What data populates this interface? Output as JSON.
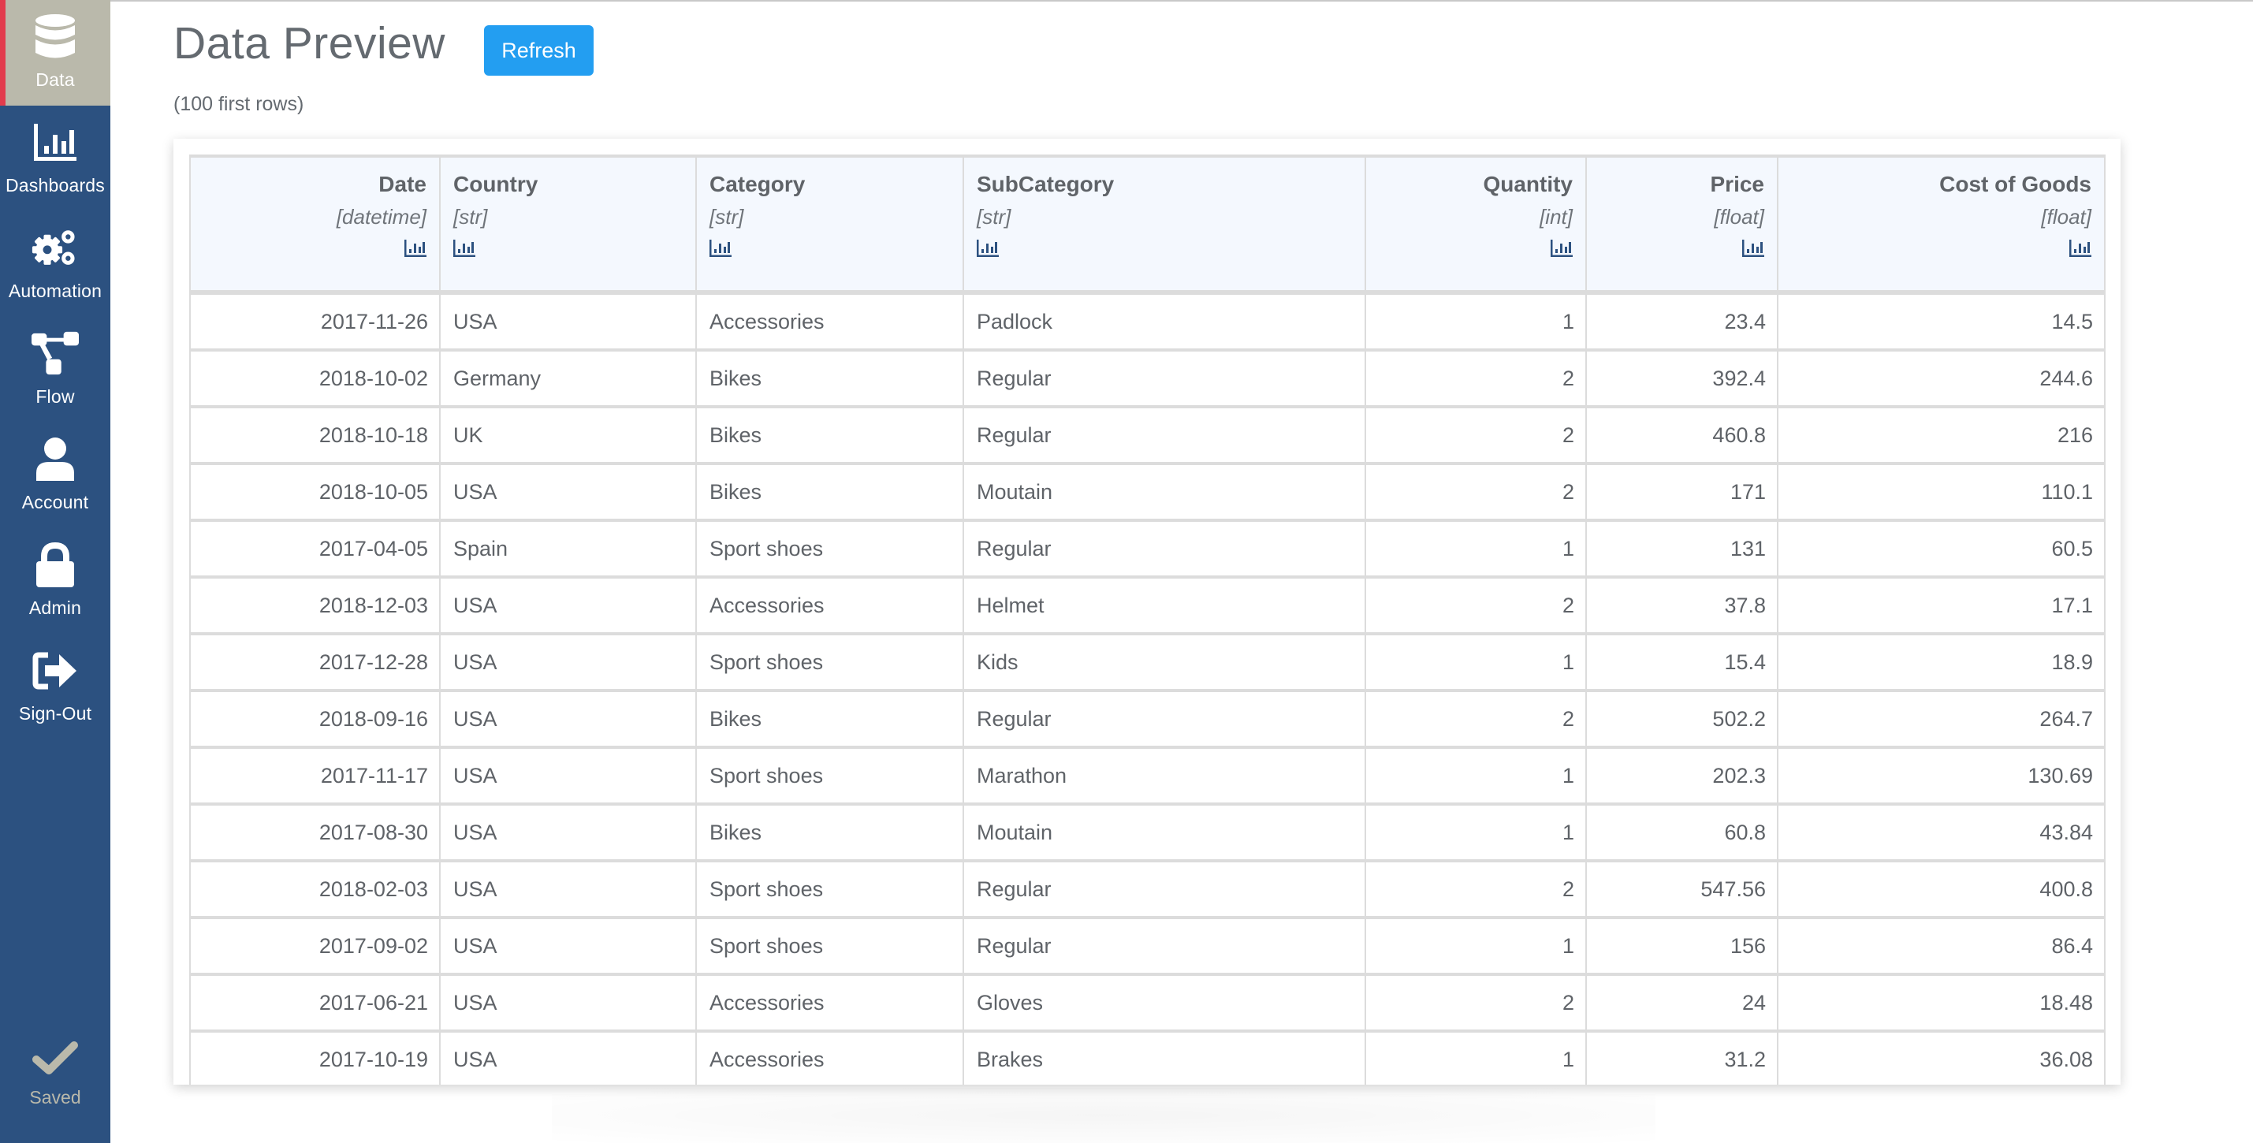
{
  "sidebar": {
    "items": [
      {
        "label": "Data",
        "icon": "database-icon",
        "active": true
      },
      {
        "label": "Dashboards",
        "icon": "bar-chart-icon",
        "active": false
      },
      {
        "label": "Automation",
        "icon": "gears-icon",
        "active": false
      },
      {
        "label": "Flow",
        "icon": "flow-icon",
        "active": false
      },
      {
        "label": "Account",
        "icon": "user-icon",
        "active": false
      },
      {
        "label": "Admin",
        "icon": "lock-icon",
        "active": false
      },
      {
        "label": "Sign-Out",
        "icon": "sign-out-icon",
        "active": false
      }
    ],
    "status": {
      "label": "Saved",
      "icon": "check-icon"
    }
  },
  "header": {
    "title": "Data Preview",
    "refresh_label": "Refresh",
    "subtitle": "(100 first rows)"
  },
  "colors": {
    "sidebar_bg": "#2c5180",
    "active_bg": "#bab9ab",
    "active_marker": "#e23b4d",
    "button": "#239ef1",
    "header_bg": "#f4f8fe"
  },
  "table": {
    "columns": [
      {
        "name": "Date",
        "type": "[datetime]",
        "align": "right"
      },
      {
        "name": "Country",
        "type": "[str]",
        "align": "left"
      },
      {
        "name": "Category",
        "type": "[str]",
        "align": "left"
      },
      {
        "name": "SubCategory",
        "type": "[str]",
        "align": "left"
      },
      {
        "name": "Quantity",
        "type": "[int]",
        "align": "right"
      },
      {
        "name": "Price",
        "type": "[float]",
        "align": "right"
      },
      {
        "name": "Cost of Goods",
        "type": "[float]",
        "align": "right"
      }
    ],
    "rows": [
      [
        "2017-11-26",
        "USA",
        "Accessories",
        "Padlock",
        "1",
        "23.4",
        "14.5"
      ],
      [
        "2018-10-02",
        "Germany",
        "Bikes",
        "Regular",
        "2",
        "392.4",
        "244.6"
      ],
      [
        "2018-10-18",
        "UK",
        "Bikes",
        "Regular",
        "2",
        "460.8",
        "216"
      ],
      [
        "2018-10-05",
        "USA",
        "Bikes",
        "Moutain",
        "2",
        "171",
        "110.1"
      ],
      [
        "2017-04-05",
        "Spain",
        "Sport shoes",
        "Regular",
        "1",
        "131",
        "60.5"
      ],
      [
        "2018-12-03",
        "USA",
        "Accessories",
        "Helmet",
        "2",
        "37.8",
        "17.1"
      ],
      [
        "2017-12-28",
        "USA",
        "Sport shoes",
        "Kids",
        "1",
        "15.4",
        "18.9"
      ],
      [
        "2018-09-16",
        "USA",
        "Bikes",
        "Regular",
        "2",
        "502.2",
        "264.7"
      ],
      [
        "2017-11-17",
        "USA",
        "Sport shoes",
        "Marathon",
        "1",
        "202.3",
        "130.69"
      ],
      [
        "2017-08-30",
        "USA",
        "Bikes",
        "Moutain",
        "1",
        "60.8",
        "43.84"
      ],
      [
        "2018-02-03",
        "USA",
        "Sport shoes",
        "Regular",
        "2",
        "547.56",
        "400.8"
      ],
      [
        "2017-09-02",
        "USA",
        "Sport shoes",
        "Regular",
        "1",
        "156",
        "86.4"
      ],
      [
        "2017-06-21",
        "USA",
        "Accessories",
        "Gloves",
        "2",
        "24",
        "18.48"
      ],
      [
        "2017-10-19",
        "USA",
        "Accessories",
        "Brakes",
        "1",
        "31.2",
        "36.08"
      ]
    ]
  }
}
